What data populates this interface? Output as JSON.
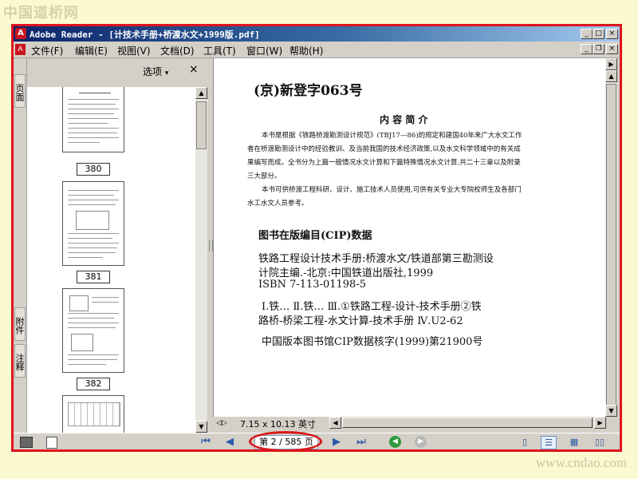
{
  "watermark": {
    "top": "中国道桥网",
    "bottom": "www.cndao.com"
  },
  "window": {
    "title": "Adobe Reader - [计技术手册+桥渡水文+1999版.pdf]",
    "controls": [
      "_",
      "□",
      "×"
    ],
    "doc_controls": [
      "_",
      "❐",
      "×"
    ]
  },
  "menu": {
    "items": [
      "文件(F)",
      "编辑(E)",
      "视图(V)",
      "文档(D)",
      "工具(T)",
      "窗口(W)",
      "帮助(H)"
    ]
  },
  "left_tabs": {
    "pages": "页面",
    "attachments": "附件",
    "comments": "注释"
  },
  "thumbnails": {
    "options": "选项",
    "options_arrow": "▾",
    "close": "×",
    "pages": [
      "380",
      "381",
      "382"
    ]
  },
  "document": {
    "registration": "(京)新登字063号",
    "summary_heading": "内 容 简 介",
    "summary_lines": [
      "本书是根据《铁路桥渡勘测设计规范》(TBJ17—86)的规定和建国40年来广大水文工作",
      "者在桥渡勘测设计中的经验教训、及当前我国的技术经济政策,以及水文科学领域中的有关成",
      "果编写而成。全书分为上篇一般情况水文计算和下篇特殊情况水文计算,共二十三章以及附录",
      "三大部分。",
      "本书可供桥渡工程科研、设计、施工技术人员使用,可供有关专业大专院校师生及各部门",
      "水工水文人员参考。"
    ],
    "cip_heading": "图书在版编目(CIP)数据",
    "cip_lines": [
      "铁路工程设计技术手册:桥渡水文/铁道部第三勘测设",
      "计院主编.-北京:中国铁道出版社,1999",
      "ISBN 7-113-01198-5"
    ],
    "class_lines": [
      "Ⅰ.铁… Ⅱ.铁… Ⅲ.①铁路工程-设计-技术手册②铁",
      "路桥-桥梁工程-水文计算-技术手册 Ⅳ.U2-62"
    ],
    "cip_number": "中国版本图书馆CIP数据核字(1999)第21900号",
    "page_size": "7.15 x 10.13 英寸"
  },
  "navigation": {
    "first": "⏮",
    "prev": "◀",
    "next": "▶",
    "last": "⏭",
    "page_indicator": "第 2 / 585 页",
    "back": "◀",
    "forward": "▶"
  }
}
